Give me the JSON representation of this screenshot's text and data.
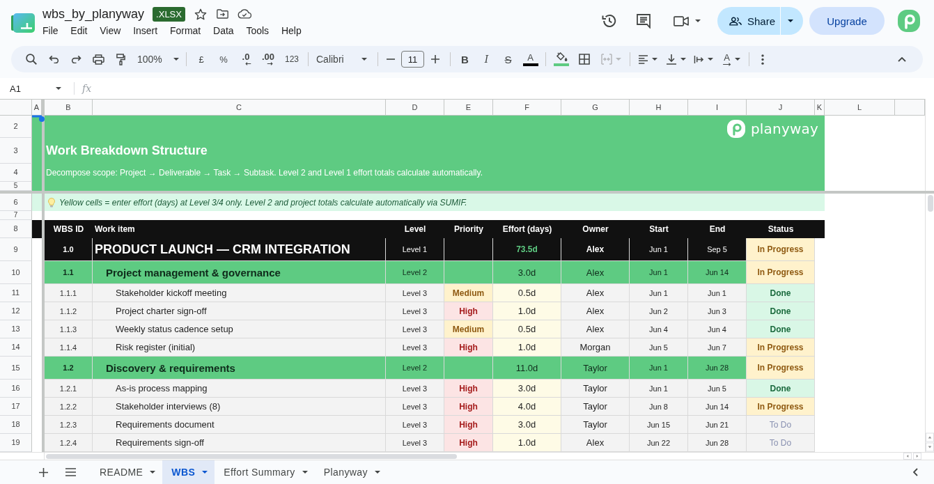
{
  "app_bar": {
    "title": "wbs_by_planyway",
    "badge": ".XLSX",
    "menu": [
      "File",
      "Edit",
      "View",
      "Insert",
      "Format",
      "Data",
      "Tools",
      "Help"
    ],
    "share_button": "Share",
    "upgrade_button": "Upgrade"
  },
  "toolbar": {
    "zoom": "100%",
    "currency": "£",
    "percent": "%",
    "decrease_decimals": ".0",
    "increase_decimals": ".00",
    "number_format": "123",
    "font": "Calibri",
    "font_size": "11",
    "bold": "B",
    "italic": "I",
    "strikethrough": "S",
    "text_color": {
      "label": "A",
      "color": "#000000"
    },
    "fill_color": {
      "color": "#5ecb82"
    },
    "merge_cells": {
      "disabled": true
    },
    "text_rotation": "A"
  },
  "formula_bar": {
    "name_box": "A1",
    "function_label": "fx"
  },
  "grid": {
    "columns": [
      "A",
      "B",
      "C",
      "D",
      "E",
      "F",
      "G",
      "H",
      "I",
      "J",
      "K",
      "L"
    ],
    "rows": [
      "2",
      "3",
      "4",
      "5",
      "6",
      "7",
      "8",
      "9",
      "10",
      "11",
      "12",
      "13",
      "14",
      "15",
      "16",
      "17",
      "18",
      "19"
    ]
  },
  "banner": {
    "title": "Work Breakdown Structure",
    "subtitle": "Decompose scope: Project → Deliverable → Task → Subtask. Level 2 and Level 1 effort totals calculate automatically.",
    "logo_text": "planyway"
  },
  "hint": "Yellow cells = enter effort (days) at Level 3/4 only. Level 2 and project totals calculate automatically via SUMIF.",
  "table": {
    "columns": [
      "WBS ID",
      "Work item",
      "Level",
      "Priority",
      "Effort (days)",
      "Owner",
      "Start",
      "End",
      "Status"
    ],
    "rows": [
      {
        "kind": "level1",
        "wbs_id": "1.0",
        "work_item": "PRODUCT LAUNCH — CRM INTEGRATION",
        "level": "Level 1",
        "effort": "73.5d",
        "owner": "Alex",
        "start": "Jun 1",
        "end": "Sep 5",
        "status": {
          "label": "In Progress",
          "kind": "in_progress"
        }
      },
      {
        "kind": "level2",
        "wbs_id": "1.1",
        "work_item": "Project management & governance",
        "level": "Level 2",
        "effort": "3.0d",
        "owner": "Alex",
        "start": "Jun 1",
        "end": "Jun 14",
        "status": {
          "label": "In Progress",
          "kind": "in_progress"
        }
      },
      {
        "kind": "level3",
        "wbs_id": "1.1.1",
        "work_item": "Stakeholder kickoff meeting",
        "level": "Level 3",
        "priority": {
          "label": "Medium",
          "kind": "medium"
        },
        "effort": "0.5d",
        "owner": "Alex",
        "start": "Jun 1",
        "end": "Jun 1",
        "status": {
          "label": "Done",
          "kind": "done"
        }
      },
      {
        "kind": "level3",
        "wbs_id": "1.1.2",
        "work_item": "Project charter sign-off",
        "level": "Level 3",
        "priority": {
          "label": "High",
          "kind": "high"
        },
        "effort": "1.0d",
        "owner": "Alex",
        "start": "Jun 2",
        "end": "Jun 3",
        "status": {
          "label": "Done",
          "kind": "done"
        }
      },
      {
        "kind": "level3",
        "wbs_id": "1.1.3",
        "work_item": "Weekly status cadence setup",
        "level": "Level 3",
        "priority": {
          "label": "Medium",
          "kind": "medium"
        },
        "effort": "0.5d",
        "owner": "Alex",
        "start": "Jun 4",
        "end": "Jun 4",
        "status": {
          "label": "Done",
          "kind": "done"
        }
      },
      {
        "kind": "level3",
        "wbs_id": "1.1.4",
        "work_item": "Risk register (initial)",
        "level": "Level 3",
        "priority": {
          "label": "High",
          "kind": "high"
        },
        "effort": "1.0d",
        "owner": "Morgan",
        "start": "Jun 5",
        "end": "Jun 7",
        "status": {
          "label": "In Progress",
          "kind": "in_progress"
        }
      },
      {
        "kind": "level2",
        "wbs_id": "1.2",
        "work_item": "Discovery & requirements",
        "level": "Level 2",
        "effort": "11.0d",
        "owner": "Taylor",
        "start": "Jun 1",
        "end": "Jun 28",
        "status": {
          "label": "In Progress",
          "kind": "in_progress"
        }
      },
      {
        "kind": "level3",
        "wbs_id": "1.2.1",
        "work_item": "As-is process mapping",
        "level": "Level 3",
        "priority": {
          "label": "High",
          "kind": "high"
        },
        "effort": "3.0d",
        "owner": "Taylor",
        "start": "Jun 1",
        "end": "Jun 5",
        "status": {
          "label": "Done",
          "kind": "done"
        }
      },
      {
        "kind": "level3",
        "wbs_id": "1.2.2",
        "work_item": "Stakeholder interviews (8)",
        "level": "Level 3",
        "priority": {
          "label": "High",
          "kind": "high"
        },
        "effort": "4.0d",
        "owner": "Taylor",
        "start": "Jun 8",
        "end": "Jun 14",
        "status": {
          "label": "In Progress",
          "kind": "in_progress"
        }
      },
      {
        "kind": "level3",
        "wbs_id": "1.2.3",
        "work_item": "Requirements document",
        "level": "Level 3",
        "priority": {
          "label": "High",
          "kind": "high"
        },
        "effort": "3.0d",
        "owner": "Taylor",
        "start": "Jun 15",
        "end": "Jun 21",
        "status": {
          "label": "To Do",
          "kind": "todo"
        }
      },
      {
        "kind": "level3",
        "wbs_id": "1.2.4",
        "work_item": "Requirements sign-off",
        "level": "Level 3",
        "priority": {
          "label": "High",
          "kind": "high"
        },
        "effort": "1.0d",
        "owner": "Alex",
        "start": "Jun 22",
        "end": "Jun 28",
        "status": {
          "label": "To Do",
          "kind": "todo"
        }
      }
    ]
  },
  "sheet_tabs": [
    {
      "label": "README",
      "selected": false
    },
    {
      "label": "WBS",
      "selected": true
    },
    {
      "label": "Effort Summary",
      "selected": false
    },
    {
      "label": "Planyway",
      "selected": false
    }
  ]
}
